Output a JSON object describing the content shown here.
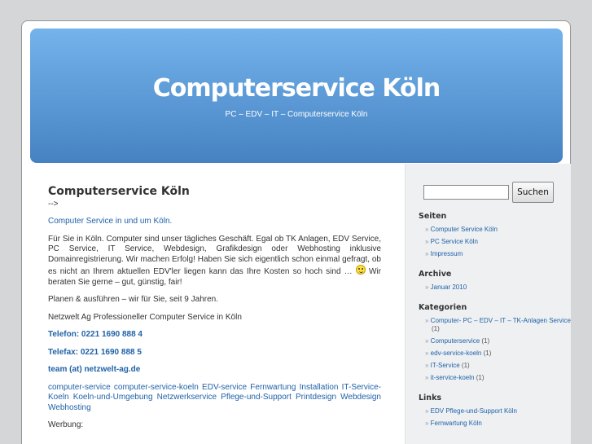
{
  "header": {
    "title": "Computerservice Köln",
    "description": "PC – EDV – IT – Computerservice Köln"
  },
  "post": {
    "title": "Computerservice Köln",
    "arrow": "-->",
    "intro_link": "Computer Service in und um Köln.",
    "paragraph1_a": "Für Sie in Köln. Computer sind unser tägliches Geschäft. Egal ob TK Anlagen, EDV Service, PC Service, IT Service, Webdesign, Grafikdesign oder Webhosting inklusive Domainregistrierung. Wir machen Erfolg! Haben Sie sich eigentlich schon einmal gefragt, ob es nicht an Ihrem aktuellen EDV'ler liegen kann das Ihre Kosten so hoch sind …",
    "paragraph1_b": "Wir beraten Sie gerne – gut, günstig, fair!",
    "paragraph2": "Planen & ausführen – wir für Sie, seit 9 Jahren.",
    "paragraph3": "Netzwelt Ag Professioneller Computer Service in Köln",
    "phone": "Telefon: 0221 1690 888 4",
    "fax": "Telefax: 0221 1690 888 5",
    "email": "team (at) netzwelt-ag.de",
    "tags": "computer-service computer-service-koeln EDV-service Fernwartung Installation IT-Service-Koeln Koeln-und-Umgebung Netzwerkservice Pflege-und-Support Printdesign Webdesign Webhosting",
    "werbung": "Werbung:"
  },
  "sidebar": {
    "search_button": "Suchen",
    "search_value": "",
    "widgets": [
      {
        "title": "Seiten",
        "items": [
          {
            "label": "Computer Service Köln",
            "count": ""
          },
          {
            "label": "PC Service Köln",
            "count": ""
          },
          {
            "label": "Impressum",
            "count": ""
          }
        ]
      },
      {
        "title": "Archive",
        "items": [
          {
            "label": "Januar 2010",
            "count": ""
          }
        ]
      },
      {
        "title": "Kategorien",
        "items": [
          {
            "label": "Computer- PC – EDV – IT – TK-Anlagen Service",
            "count": "(1)"
          },
          {
            "label": "Computerservice",
            "count": "(1)"
          },
          {
            "label": "edv-service-koeln",
            "count": "(1)"
          },
          {
            "label": "IT-Service",
            "count": "(1)"
          },
          {
            "label": "it-service-koeln",
            "count": "(1)"
          }
        ]
      },
      {
        "title": "Links",
        "items": [
          {
            "label": "EDV Pflege-und-Support Köln",
            "count": ""
          },
          {
            "label": "Fernwartung Köln",
            "count": ""
          }
        ]
      }
    ]
  },
  "colors": {
    "header_top": "#74b3ec",
    "header_bottom": "#4682c2",
    "link": "#2162a8",
    "sidebar_bg": "#eef0f2"
  }
}
